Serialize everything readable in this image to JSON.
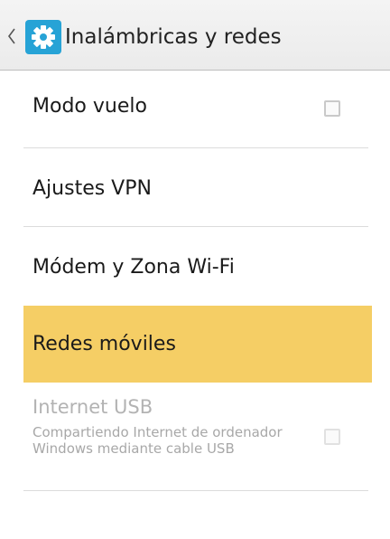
{
  "action_bar": {
    "title": "Inalámbricas y redes",
    "icon": "settings-gear-icon",
    "back_icon": "chevron-left-icon",
    "icon_color": "#27a3d6"
  },
  "items": [
    {
      "label": "Modo vuelo",
      "checkbox": true,
      "checked": false,
      "enabled": true
    },
    {
      "label": "Ajustes VPN",
      "checkbox": false,
      "enabled": true
    },
    {
      "label": "Módem y Zona Wi-Fi",
      "checkbox": false,
      "enabled": true
    },
    {
      "label": "Redes móviles",
      "checkbox": false,
      "enabled": true,
      "highlighted": true
    },
    {
      "label": "Internet USB",
      "summary": "Compartiendo Internet de ordenador Windows mediante cable USB",
      "checkbox": true,
      "checked": false,
      "enabled": false
    }
  ],
  "colors": {
    "highlight": "#f5ce65",
    "divider": "#dcdcdc",
    "disabled_text": "#b3b3b3"
  }
}
